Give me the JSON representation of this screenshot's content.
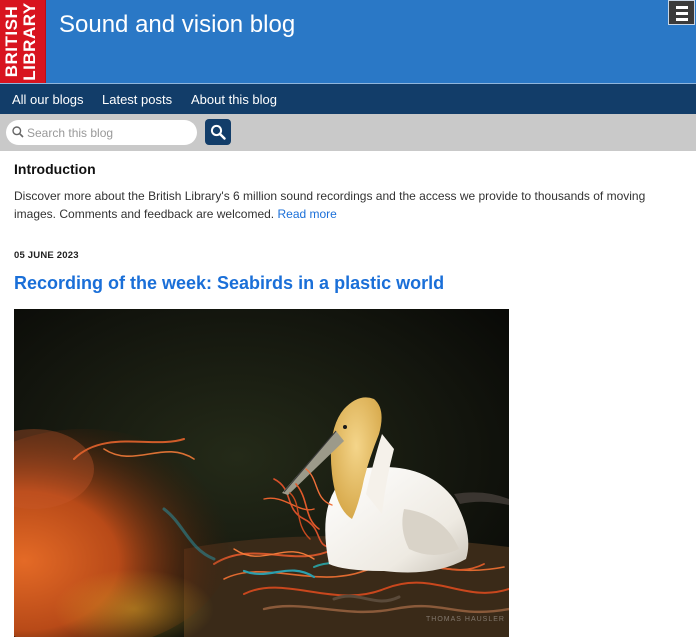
{
  "header": {
    "logo_line1": "BRITISH",
    "logo_line2": "LIBRARY",
    "site_title": "Sound and vision blog",
    "menu_icon": "hamburger-menu-icon"
  },
  "nav": {
    "items": [
      {
        "label": "All our blogs"
      },
      {
        "label": "Latest posts"
      },
      {
        "label": "About this blog"
      }
    ]
  },
  "search": {
    "placeholder": "Search this blog",
    "search_icon": "magnifier-icon"
  },
  "intro": {
    "heading": "Introduction",
    "text": "Discover more about the British Library's 6 million sound recordings and the access we provide to thousands of moving images. Comments and feedback are welcomed.",
    "read_more": "Read more"
  },
  "post": {
    "date": "05 JUNE 2023",
    "title": "Recording of the week: Seabirds in a plastic world",
    "image_watermark": "THOMAS HAUSLER"
  },
  "colors": {
    "header_blue": "#2a78c6",
    "nav_navy": "#123d69",
    "logo_red": "#d8141f",
    "link_blue": "#1a6fd8",
    "search_bar_grey": "#c9c9c9"
  }
}
